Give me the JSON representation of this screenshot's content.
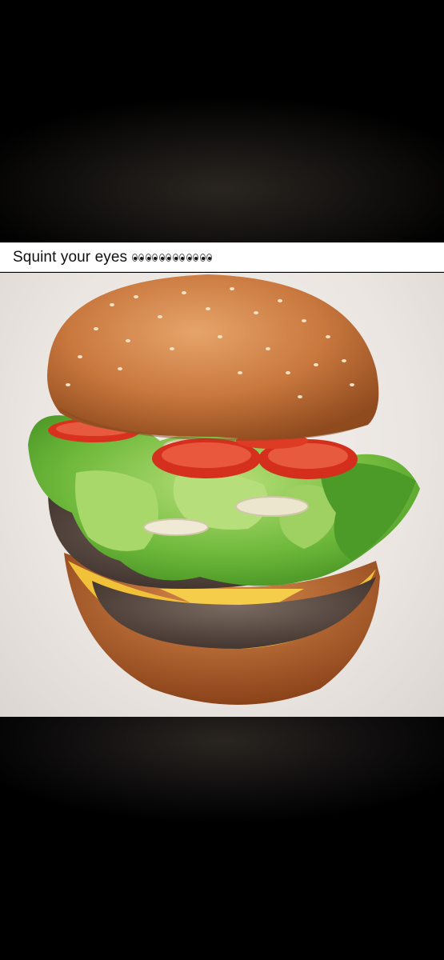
{
  "post": {
    "caption": "Squint your eyes",
    "emoji_icon": "eyes-emoji",
    "emoji_count": 6
  },
  "image": {
    "subject": "burger-photo"
  },
  "colors": {
    "bun": "#c9783e",
    "lettuce": "#5fae2e",
    "tomato": "#d8321f",
    "cheese": "#f1c13a",
    "patty": "#5a4a42"
  }
}
